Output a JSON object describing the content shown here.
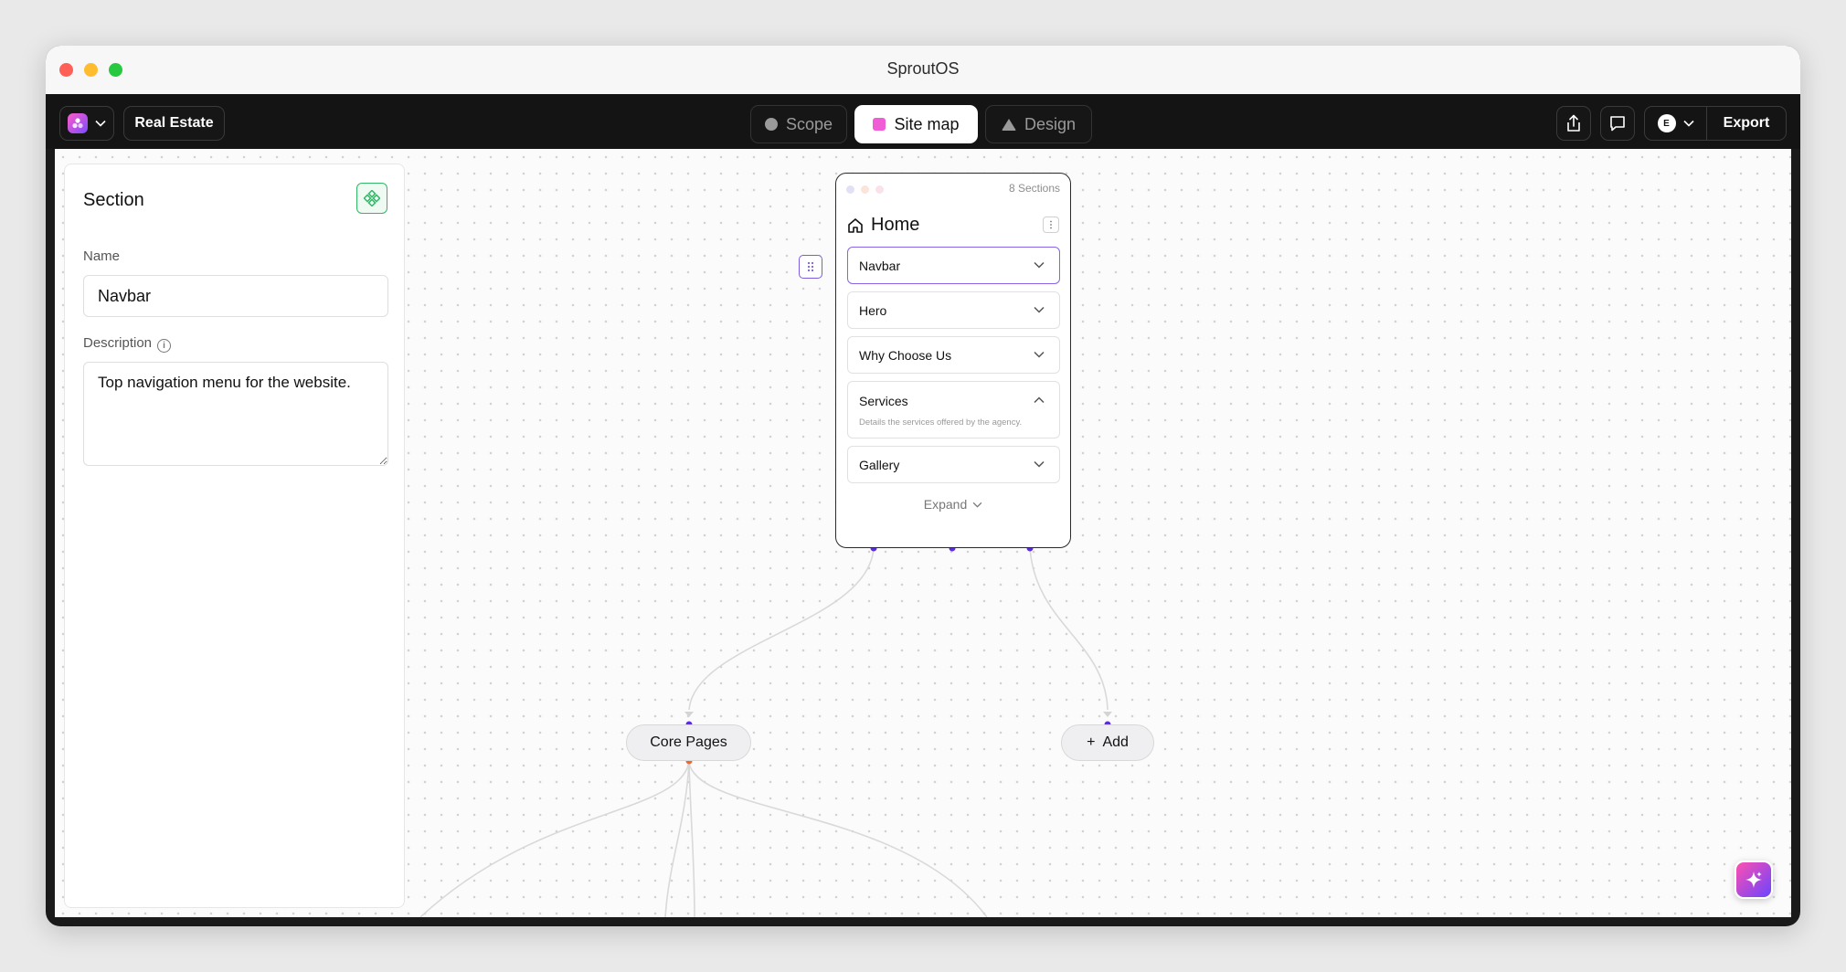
{
  "window": {
    "title": "SproutOS"
  },
  "toolbar": {
    "project_label": "Real Estate",
    "tabs": [
      {
        "label": "Scope",
        "icon": "circle-icon",
        "active": false
      },
      {
        "label": "Site map",
        "icon": "square-icon",
        "active": true
      },
      {
        "label": "Design",
        "icon": "triangle-icon",
        "active": false
      }
    ],
    "editor_logo_letter": "E",
    "export_label": "Export"
  },
  "panel": {
    "title": "Section",
    "name_label": "Name",
    "name_value": "Navbar",
    "description_label": "Description",
    "description_value": "Top navigation menu for the website."
  },
  "page_card": {
    "sections_count": "8 Sections",
    "title": "Home",
    "sections": [
      {
        "label": "Navbar",
        "expanded": false,
        "selected": true
      },
      {
        "label": "Hero",
        "expanded": false,
        "selected": false
      },
      {
        "label": "Why Choose Us",
        "expanded": false,
        "selected": false
      },
      {
        "label": "Services",
        "expanded": true,
        "selected": false,
        "description": "Details the services offered by the agency."
      },
      {
        "label": "Gallery",
        "expanded": false,
        "selected": false
      }
    ],
    "expand_label": "Expand"
  },
  "nodes": {
    "core_pages": "Core Pages",
    "add": "Add",
    "add_symbol": "+"
  },
  "colors": {
    "accent": "#7b5ce0",
    "connector_dot": "#5b2fd6",
    "orange_dot": "#f0692a",
    "site_map_icon": "#f05bd6",
    "panel_icon_green": "#34b867"
  }
}
